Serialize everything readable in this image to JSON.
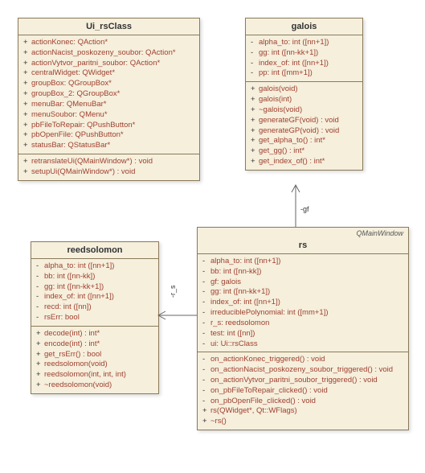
{
  "classes": {
    "ui_rs": {
      "name": "Ui_rsClass",
      "attributes": [
        {
          "v": "+",
          "t": "actionKonec: QAction*"
        },
        {
          "v": "+",
          "t": "actionNacist_poskozeny_soubor: QAction*"
        },
        {
          "v": "+",
          "t": "actionVytvor_paritni_soubor: QAction*"
        },
        {
          "v": "+",
          "t": "centralWidget: QWidget*"
        },
        {
          "v": "+",
          "t": "groupBox: QGroupBox*"
        },
        {
          "v": "+",
          "t": "groupBox_2: QGroupBox*"
        },
        {
          "v": "+",
          "t": "menuBar: QMenuBar*"
        },
        {
          "v": "+",
          "t": "menuSoubor: QMenu*"
        },
        {
          "v": "+",
          "t": "pbFileToRepair: QPushButton*"
        },
        {
          "v": "+",
          "t": "pbOpenFile: QPushButton*"
        },
        {
          "v": "+",
          "t": "statusBar: QStatusBar*"
        }
      ],
      "operations": [
        {
          "v": "+",
          "t": "retranslateUi(QMainWindow*) : void"
        },
        {
          "v": "+",
          "t": "setupUi(QMainWindow*) : void"
        }
      ]
    },
    "galois": {
      "name": "galois",
      "attributes": [
        {
          "v": "-",
          "t": "alpha_to: int ([nn+1])"
        },
        {
          "v": "-",
          "t": "gg: int ([nn-kk+1])"
        },
        {
          "v": "-",
          "t": "index_of: int ([nn+1])"
        },
        {
          "v": "-",
          "t": "pp: int ([mm+1])"
        }
      ],
      "operations": [
        {
          "v": "+",
          "t": "galois(void)"
        },
        {
          "v": "+",
          "t": "galois(int)"
        },
        {
          "v": "+",
          "t": "~galois(void)"
        },
        {
          "v": "+",
          "t": "generateGF(void) : void"
        },
        {
          "v": "+",
          "t": "generateGP(void) : void"
        },
        {
          "v": "+",
          "t": "get_alpha_to() : int*"
        },
        {
          "v": "+",
          "t": "get_gg() : int*"
        },
        {
          "v": "+",
          "t": "get_index_of() : int*"
        }
      ]
    },
    "reedsolomon": {
      "name": "reedsolomon",
      "attributes": [
        {
          "v": "-",
          "t": "alpha_to: int ([nn+1])"
        },
        {
          "v": "-",
          "t": "bb: int ([nn-kk])"
        },
        {
          "v": "-",
          "t": "gg: int ([nn-kk+1])"
        },
        {
          "v": "-",
          "t": "index_of: int ([nn+1])"
        },
        {
          "v": "-",
          "t": "recd: int ([nn])"
        },
        {
          "v": "-",
          "t": "rsErr: bool"
        }
      ],
      "operations": [
        {
          "v": "+",
          "t": "decode(int) : int*"
        },
        {
          "v": "+",
          "t": "encode(int) : int*"
        },
        {
          "v": "+",
          "t": "get_rsErr() : bool"
        },
        {
          "v": "+",
          "t": "reedsolomon(void)"
        },
        {
          "v": "+",
          "t": "reedsolomon(int, int, int)"
        },
        {
          "v": "+",
          "t": "~reedsolomon(void)"
        }
      ]
    },
    "rs": {
      "name": "rs",
      "stereotype": "QMainWindow",
      "attributes": [
        {
          "v": "-",
          "t": "alpha_to: int ([nn+1])"
        },
        {
          "v": "-",
          "t": "bb: int ([nn-kk])"
        },
        {
          "v": "-",
          "t": "gf: galois"
        },
        {
          "v": "-",
          "t": "gg: int ([nn-kk+1])"
        },
        {
          "v": "-",
          "t": "index_of: int ([nn+1])"
        },
        {
          "v": "-",
          "t": "irreduciblePolynomial: int ([mm+1])"
        },
        {
          "v": "-",
          "t": "r_s: reedsolomon"
        },
        {
          "v": "-",
          "t": "test: int ([nn])"
        },
        {
          "v": "-",
          "t": "ui: Ui::rsClass"
        }
      ],
      "operations": [
        {
          "v": "-",
          "t": "on_actionKonec_triggered() : void"
        },
        {
          "v": "-",
          "t": "on_actionNacist_poskozeny_soubor_triggered() : void"
        },
        {
          "v": "-",
          "t": "on_actionVytvor_paritni_soubor_triggered() : void"
        },
        {
          "v": "-",
          "t": "on_pbFileToRepair_clicked() : void"
        },
        {
          "v": "-",
          "t": "on_pbOpenFile_clicked() : void"
        },
        {
          "v": "+",
          "t": "rs(QWidget*, Qt::WFlags)"
        },
        {
          "v": "+",
          "t": "~rs()"
        }
      ]
    }
  },
  "labels": {
    "gf": "-gf",
    "r_s": "-r_s"
  }
}
